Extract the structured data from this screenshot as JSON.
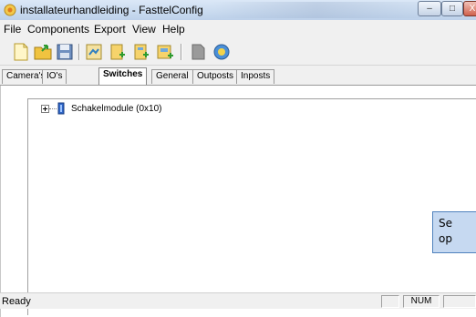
{
  "window": {
    "title": "installateurhandleiding - FasttelConfig",
    "minimize_glyph": "–",
    "maximize_glyph": "□",
    "close_glyph": "X"
  },
  "menu": [
    {
      "label": "File"
    },
    {
      "label": "Components"
    },
    {
      "label": "Export"
    },
    {
      "label": "View"
    },
    {
      "label": "Help"
    }
  ],
  "toolbar": {
    "buttons": [
      {
        "icon": "new-file-icon"
      },
      {
        "icon": "open-folder-icon"
      },
      {
        "icon": "save-disk-icon"
      },
      {
        "icon": "add-component-icon"
      },
      {
        "icon": "add-input-icon"
      },
      {
        "icon": "add-output-icon"
      },
      {
        "icon": "add-module-icon"
      },
      {
        "icon": "document-icon"
      },
      {
        "icon": "help-icon"
      }
    ]
  },
  "tabs": [
    {
      "label": "Camera's",
      "active": false
    },
    {
      "label": "IO's",
      "active": false
    },
    {
      "label": "Switches",
      "active": true
    },
    {
      "label": "General",
      "active": false
    },
    {
      "label": "Outposts",
      "active": false
    },
    {
      "label": "Inposts",
      "active": false
    }
  ],
  "tree": {
    "nodes": [
      {
        "label": "Schakelmodule (0x10)",
        "expanded": false
      }
    ]
  },
  "callout": {
    "line1": "Se",
    "line2": "op"
  },
  "status": {
    "text": "Ready",
    "num": "NUM"
  },
  "colors": {
    "callout_fill": "#c6d9f1",
    "callout_border": "#4f81bd"
  }
}
